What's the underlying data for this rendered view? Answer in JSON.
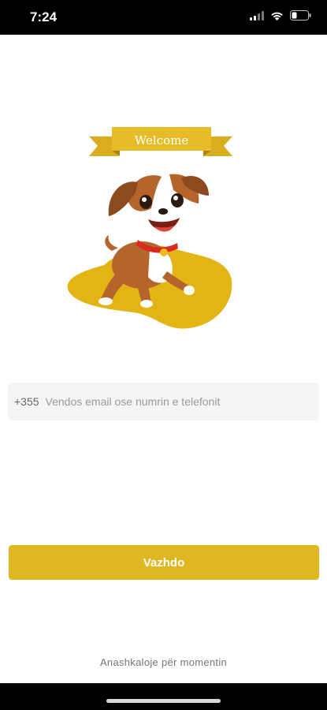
{
  "status_bar": {
    "time": "7:24"
  },
  "hero": {
    "banner_text": "Welcome"
  },
  "login": {
    "country_code": "+355",
    "placeholder": "Vendos email ose numrin e telefonit",
    "value": ""
  },
  "actions": {
    "continue_label": "Vazhdo",
    "skip_label": "Anashkaloje për momentin"
  },
  "colors": {
    "accent": "#dfb723",
    "banner": "#e6bd28",
    "blob": "#e2b515",
    "dog_brown": "#b5652c",
    "collar": "#d82a1f"
  },
  "icons": [
    "signal-icon",
    "wifi-icon",
    "battery-icon",
    "dog-illustration",
    "welcome-ribbon"
  ]
}
